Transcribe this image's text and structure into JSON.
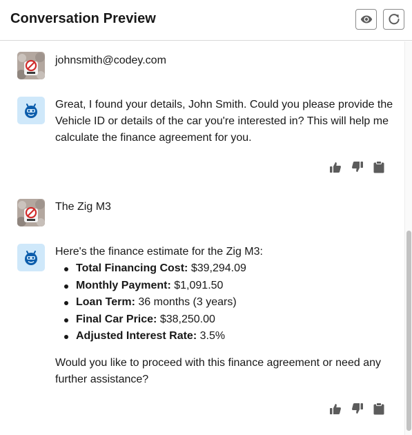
{
  "header": {
    "title": "Conversation Preview",
    "preview_icon": "eye-icon",
    "refresh_icon": "refresh-icon"
  },
  "messages": [
    {
      "sender": "user",
      "text": "johnsmith@codey.com"
    },
    {
      "sender": "bot",
      "text": "Great, I found your details, John Smith. Could you please provide the Vehicle ID or details of the car you're interested in? This will help me calculate the finance agreement for you."
    },
    {
      "sender": "user",
      "text": "The Zig M3"
    },
    {
      "sender": "bot",
      "intro": "Here's the finance estimate for the Zig M3:",
      "items": [
        {
          "label": "Total Financing Cost:",
          "value": "$39,294.09"
        },
        {
          "label": "Monthly Payment:",
          "value": "$1,091.50"
        },
        {
          "label": "Loan Term:",
          "value": "36 months (3 years)"
        },
        {
          "label": "Final Car Price:",
          "value": "$38,250.00"
        },
        {
          "label": "Adjusted Interest Rate:",
          "value": "3.5%"
        }
      ],
      "outro": "Would you like to proceed with this finance agreement or need any further assistance?"
    }
  ],
  "feedback_icons": [
    "thumbs-up-icon",
    "thumbs-down-icon",
    "clipboard-icon"
  ],
  "colors": {
    "text": "#181818",
    "icon": "#5c5c5c",
    "bot_avatar_bg": "#cfe8fa",
    "bot_avatar_fg": "#0b5cab",
    "border": "#d8d8d8"
  }
}
